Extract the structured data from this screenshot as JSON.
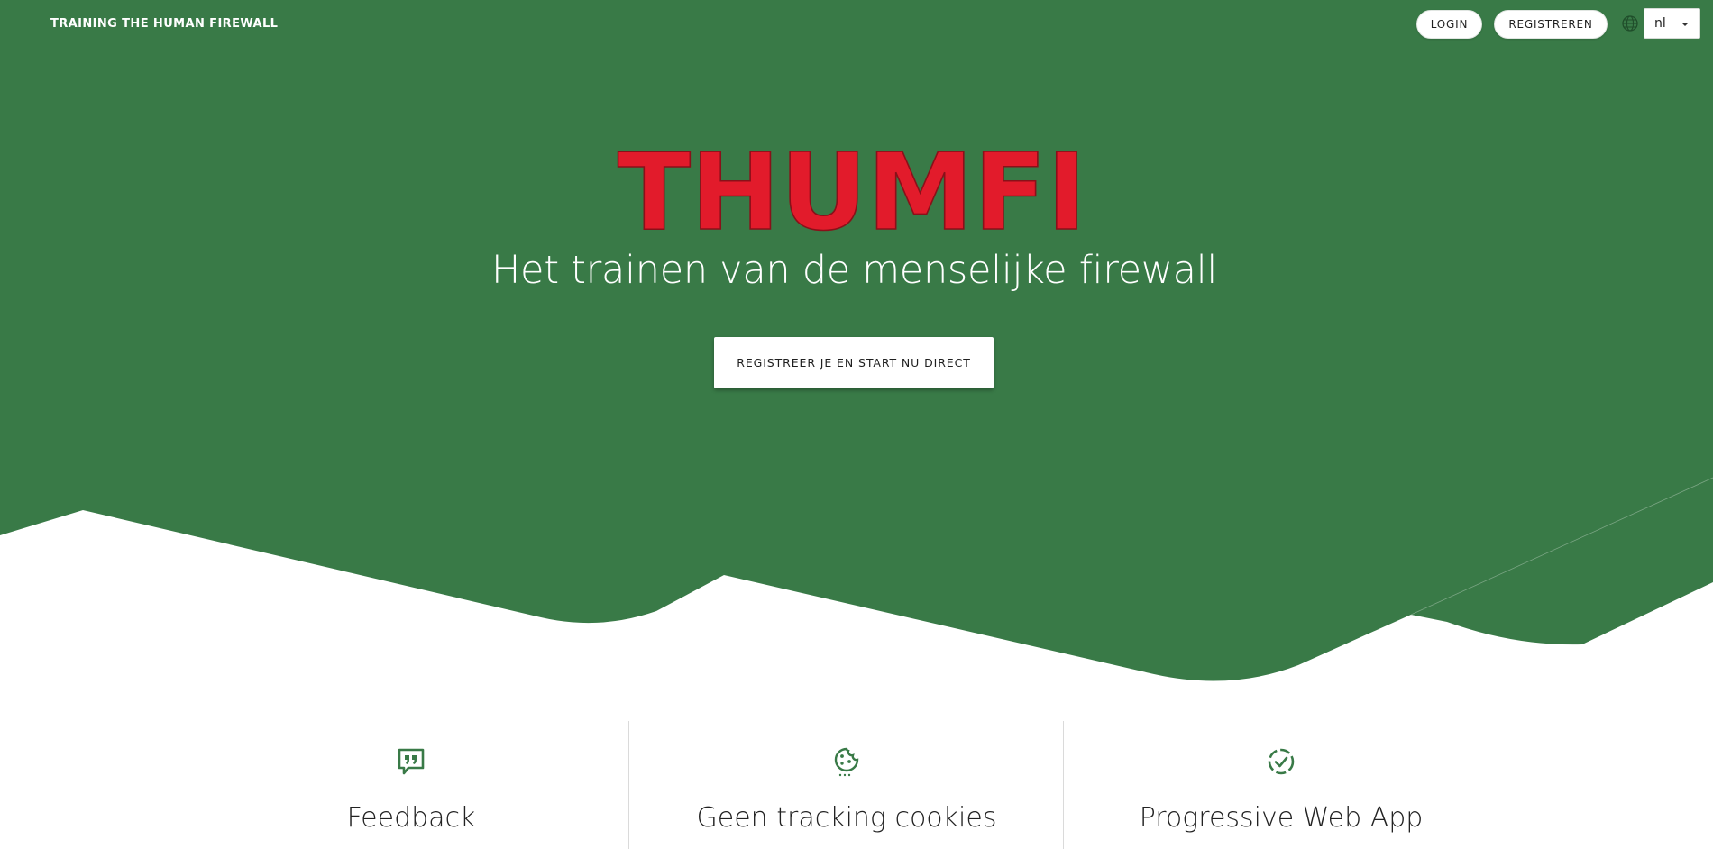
{
  "colors": {
    "brand_green": "#397a47",
    "logo_red": "#e21b2b",
    "background": "#ffffff"
  },
  "header": {
    "site_name": "TRAINING THE HUMAN FIREWALL",
    "login_label": "LOGIN",
    "register_label": "REGISTREREN",
    "language_icon": "globe-icon",
    "language_value": "nl"
  },
  "hero": {
    "logo_text": "THUMFI",
    "tagline": "Het trainen van de menselijke firewall",
    "cta_label": "REGISTREER JE EN START NU DIRECT"
  },
  "features": [
    {
      "icon": "feedback-quote-icon",
      "title": "Feedback"
    },
    {
      "icon": "cookie-icon",
      "title": "Geen tracking cookies"
    },
    {
      "icon": "dashed-check-circle-icon",
      "title": "Progressive Web App"
    }
  ]
}
